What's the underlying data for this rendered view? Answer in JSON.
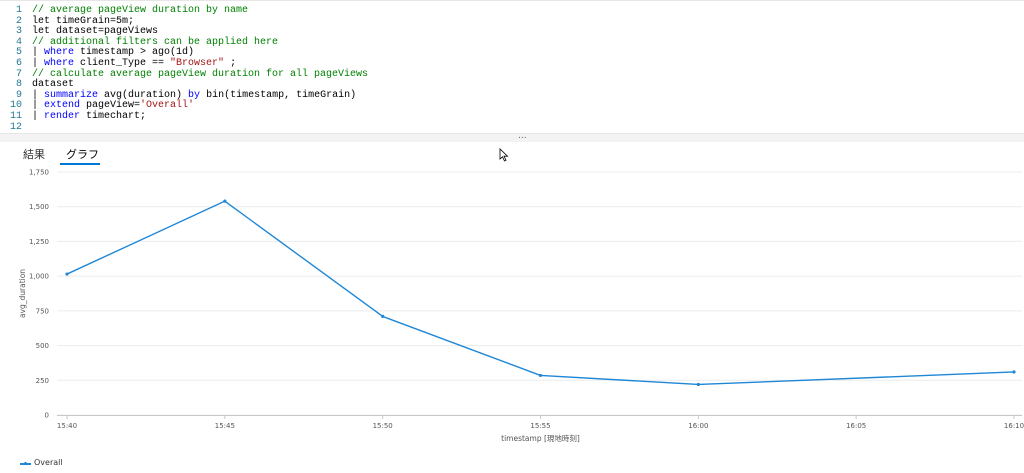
{
  "editor": {
    "lines": [
      {
        "num": "1",
        "tokens": [
          {
            "t": "// average pageView duration by name",
            "c": "comment"
          }
        ]
      },
      {
        "num": "2",
        "tokens": [
          {
            "t": "let timeGrain=5m;",
            "c": "plain"
          }
        ]
      },
      {
        "num": "3",
        "tokens": [
          {
            "t": "let dataset=pageViews",
            "c": "plain"
          }
        ]
      },
      {
        "num": "4",
        "tokens": [
          {
            "t": "// additional filters can be applied here",
            "c": "comment"
          }
        ]
      },
      {
        "num": "5",
        "tokens": [
          {
            "t": "| ",
            "c": "plain"
          },
          {
            "t": "where",
            "c": "kw"
          },
          {
            "t": " timestamp > ago(1d)",
            "c": "plain"
          }
        ]
      },
      {
        "num": "6",
        "tokens": [
          {
            "t": "| ",
            "c": "plain"
          },
          {
            "t": "where",
            "c": "kw"
          },
          {
            "t": " client_Type == ",
            "c": "plain"
          },
          {
            "t": "\"Browser\"",
            "c": "str"
          },
          {
            "t": " ;",
            "c": "plain"
          }
        ]
      },
      {
        "num": "7",
        "tokens": [
          {
            "t": "// calculate average pageView duration for all pageViews",
            "c": "comment"
          }
        ]
      },
      {
        "num": "8",
        "tokens": [
          {
            "t": "dataset",
            "c": "plain"
          }
        ]
      },
      {
        "num": "9",
        "tokens": [
          {
            "t": "| ",
            "c": "plain"
          },
          {
            "t": "summarize",
            "c": "kw"
          },
          {
            "t": " avg(duration) ",
            "c": "plain"
          },
          {
            "t": "by",
            "c": "kw"
          },
          {
            "t": " bin(timestamp, timeGrain)",
            "c": "plain"
          }
        ]
      },
      {
        "num": "10",
        "tokens": [
          {
            "t": "| ",
            "c": "plain"
          },
          {
            "t": "extend",
            "c": "kw"
          },
          {
            "t": " pageView=",
            "c": "plain"
          },
          {
            "t": "'Overall'",
            "c": "str"
          }
        ]
      },
      {
        "num": "11",
        "tokens": [
          {
            "t": "| ",
            "c": "plain"
          },
          {
            "t": "render",
            "c": "kw"
          },
          {
            "t": " timechart;",
            "c": "plain"
          }
        ]
      },
      {
        "num": "12",
        "tokens": []
      }
    ],
    "splitter_label": "..."
  },
  "tabs": {
    "results_label": "結果",
    "chart_label": "グラフ",
    "active": "chart"
  },
  "colors": {
    "series": "#1f87d6",
    "grid": "#ececec",
    "tab_accent": "#0078d4"
  },
  "chart_data": {
    "type": "line",
    "xlabel": "timestamp [現地時刻]",
    "ylabel": "avg_duration",
    "x_ticks": [
      "15:40",
      "15:45",
      "15:50",
      "15:55",
      "16:00",
      "16:05",
      "16:10"
    ],
    "y_ticks": [
      "0",
      "250",
      "500",
      "750",
      "1,000",
      "1,250",
      "1,500",
      "1,750"
    ],
    "ylim": [
      0,
      1750
    ],
    "grid": true,
    "legend": "bottom-left",
    "series": [
      {
        "name": "Overall",
        "x": [
          "15:40",
          "15:45",
          "15:50",
          "15:55",
          "16:00",
          "16:10"
        ],
        "values": [
          1015,
          1540,
          710,
          285,
          220,
          310
        ]
      }
    ]
  }
}
